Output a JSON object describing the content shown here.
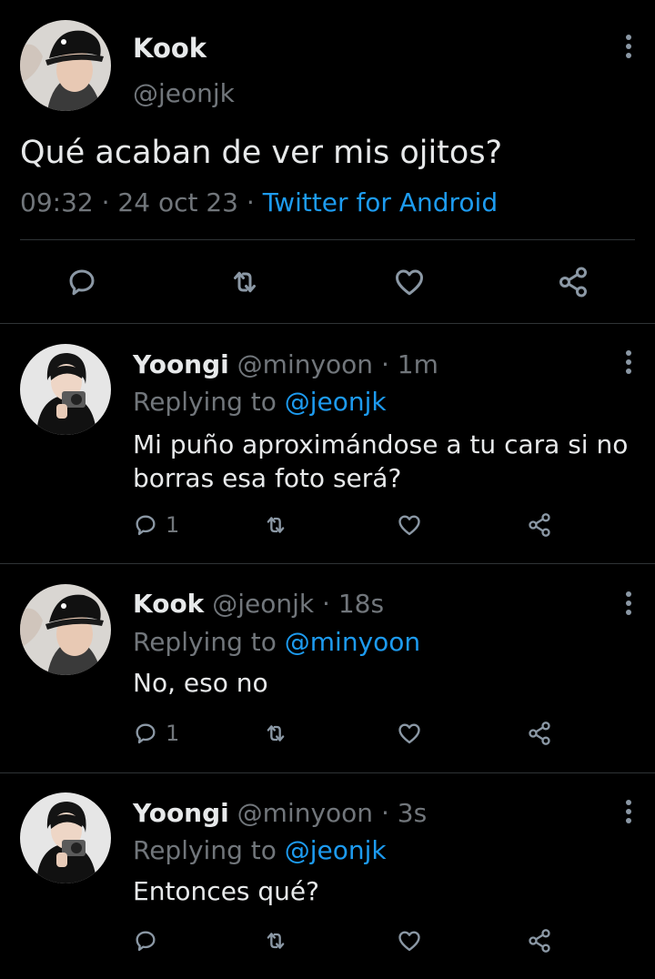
{
  "main_tweet": {
    "name": "Kook",
    "handle": "@jeonjk",
    "text": "Qué acaban de ver mis ojitos?",
    "time": "09:32",
    "sep1": "·",
    "date": "24 oct 23",
    "sep2": "·",
    "source": "Twitter for Android"
  },
  "replies": [
    {
      "name": "Yoongi",
      "handle": "@minyoon",
      "sep": "·",
      "time": "1m",
      "replying_prefix": "Replying to",
      "replying_to": "@jeonjk",
      "text_line1": "Mi puño aproximándose a tu cara si no",
      "text_line2": "borras esa foto será?",
      "reply_count": "1"
    },
    {
      "name": "Kook",
      "handle": "@jeonjk",
      "sep": "·",
      "time": "18s",
      "replying_prefix": "Replying to",
      "replying_to": "@minyoon",
      "text_line1": "No, eso no",
      "reply_count": "1"
    },
    {
      "name": "Yoongi",
      "handle": "@minyoon",
      "sep": "·",
      "time": "3s",
      "replying_prefix": "Replying to",
      "replying_to": "@jeonjk",
      "text_line1": "Entonces qué?",
      "reply_count": ""
    }
  ],
  "colors": {
    "background": "#000000",
    "accent": "#1d9bf0",
    "muted": "#71767b",
    "divider": "#2f3336"
  },
  "icons": [
    "reply-icon",
    "retweet-icon",
    "like-icon",
    "share-icon",
    "more-icon"
  ]
}
